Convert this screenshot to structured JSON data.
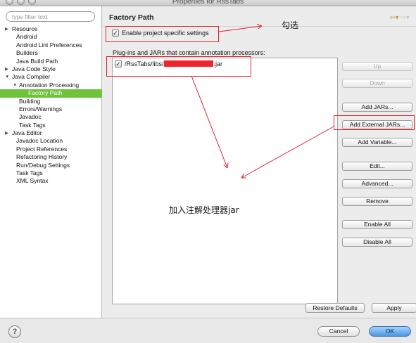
{
  "window": {
    "title": "Properties for RssTabs"
  },
  "filter": {
    "placeholder": "type filter text"
  },
  "tree": [
    {
      "label": "Resource",
      "arrow": "▶",
      "indent": 0
    },
    {
      "label": "Android",
      "arrow": "",
      "indent": 0
    },
    {
      "label": "Android Lint Preferences",
      "arrow": "",
      "indent": 0
    },
    {
      "label": "Builders",
      "arrow": "",
      "indent": 0
    },
    {
      "label": "Java Build Path",
      "arrow": "",
      "indent": 0
    },
    {
      "label": "Java Code Style",
      "arrow": "▶",
      "indent": 0
    },
    {
      "label": "Java Compiler",
      "arrow": "▼",
      "indent": 0
    },
    {
      "label": "Annotation Processing",
      "arrow": "▼",
      "indent": 1
    },
    {
      "label": "Factory Path",
      "arrow": "",
      "indent": 2,
      "selected": true
    },
    {
      "label": "Building",
      "arrow": "",
      "indent": 1
    },
    {
      "label": "Errors/Warnings",
      "arrow": "",
      "indent": 1
    },
    {
      "label": "Javadoc",
      "arrow": "",
      "indent": 1
    },
    {
      "label": "Task Tags",
      "arrow": "",
      "indent": 1
    },
    {
      "label": "Java Editor",
      "arrow": "▶",
      "indent": 0
    },
    {
      "label": "Javadoc Location",
      "arrow": "",
      "indent": 0
    },
    {
      "label": "Project References",
      "arrow": "",
      "indent": 0
    },
    {
      "label": "Refactoring History",
      "arrow": "",
      "indent": 0
    },
    {
      "label": "Run/Debug Settings",
      "arrow": "",
      "indent": 0
    },
    {
      "label": "Task Tags",
      "arrow": "",
      "indent": 0
    },
    {
      "label": "XML Syntax",
      "arrow": "",
      "indent": 0
    }
  ],
  "page": {
    "title": "Factory Path",
    "enable_label": "Enable project specific settings",
    "enable_checked": true,
    "list_label": "Plug-ins and JARs that contain annotation processors:",
    "jar_prefix": "/RssTabs/libs/",
    "jar_suffix": ".jar",
    "jar_checked": true
  },
  "buttons": {
    "up": "Up",
    "down": "Down",
    "add_jars": "Add JARs...",
    "add_external_jars": "Add External JARs...",
    "add_variable": "Add Variable...",
    "edit": "Edit...",
    "advanced": "Advanced...",
    "remove": "Remove",
    "enable_all": "Enable All",
    "disable_all": "Disable All",
    "restore_defaults": "Restore Defaults",
    "apply": "Apply"
  },
  "footer": {
    "help": "?",
    "cancel": "Cancel",
    "ok": "OK"
  },
  "annotations": {
    "check_note": "勾选",
    "add_note": "加入注解处理器jar",
    "color": "#e0242e"
  }
}
